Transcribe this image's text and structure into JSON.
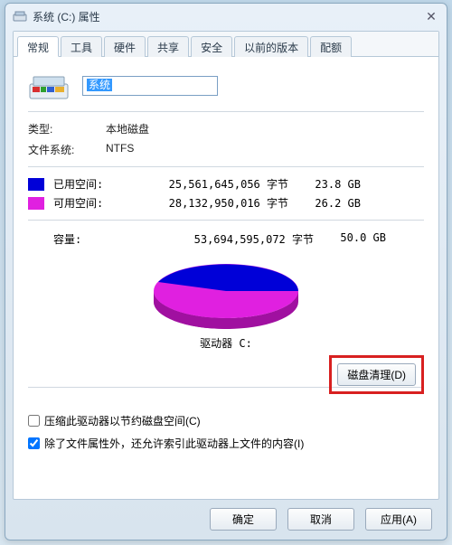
{
  "window": {
    "title": "系统 (C:) 属性"
  },
  "tabs": {
    "general": "常规",
    "tools": "工具",
    "hardware": "硬件",
    "sharing": "共享",
    "security": "安全",
    "previous": "以前的版本",
    "quota": "配额"
  },
  "drive_name": "系统",
  "type_label": "类型:",
  "type_value": "本地磁盘",
  "fs_label": "文件系统:",
  "fs_value": "NTFS",
  "used_label": "已用空间:",
  "used_bytes": "25,561,645,056 字节",
  "used_gb": "23.8 GB",
  "free_label": "可用空间:",
  "free_bytes": "28,132,950,016 字节",
  "free_gb": "26.2 GB",
  "capacity_label": "容量:",
  "capacity_bytes": "53,694,595,072 字节",
  "capacity_gb": "50.0 GB",
  "drive_caption": "驱动器 C:",
  "cleanup_button": "磁盘清理(D)",
  "compress_label": "压缩此驱动器以节约磁盘空间(C)",
  "index_label": "除了文件属性外，还允许索引此驱动器上文件的内容(I)",
  "compress_checked": false,
  "index_checked": true,
  "buttons": {
    "ok": "确定",
    "cancel": "取消",
    "apply": "应用(A)"
  },
  "colors": {
    "used": "#0000d8",
    "free": "#e020e0"
  },
  "chart_data": {
    "type": "pie",
    "title": "驱动器 C:",
    "series": [
      {
        "name": "已用空间",
        "value": 25561645056,
        "display": "23.8 GB",
        "color": "#0000d8"
      },
      {
        "name": "可用空间",
        "value": 28132950016,
        "display": "26.2 GB",
        "color": "#e020e0"
      }
    ],
    "total": 53694595072,
    "total_display": "50.0 GB"
  }
}
